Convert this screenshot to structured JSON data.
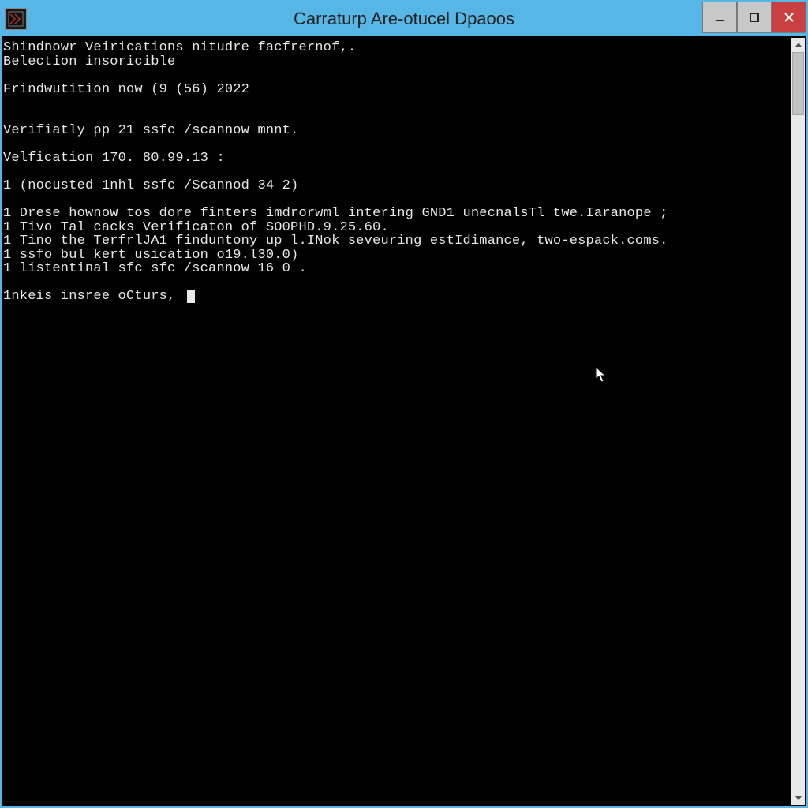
{
  "window": {
    "title": "Carraturp Are-otucel Dpaoos"
  },
  "terminal": {
    "lines": [
      "Shindnowr Veirications nitudre facfrernof,.",
      "Belection insoricible",
      "",
      "Frindwutition now (9 (56) 2022",
      "",
      "",
      "Verifiatly pp 21 ssfc /scannow mnnt.",
      "",
      "Velfication 170. 80.99.13 :",
      "",
      "1 (nocusted 1nhl ssfc /Scannod 34 2)",
      "",
      "1 Drese hownow tos dore finters imdrorwml intering GND1 unecnalsTl twe.Iaranope ;",
      "1 Tivo Tal cacks Verificaton of SO0PHD.9.25.60.",
      "1 Tino the TerfrlJA1 finduntony up l.INok seveuring estIdimance, two-espack.coms.",
      "1 ssfo bul kert usication o19.l30.0)",
      "1 listentinal sfc sfc /scannow 16 0 ."
    ],
    "prompt": "1nkeis insree oCturs, "
  },
  "controls": {
    "minimize": "minimize",
    "maximize": "maximize",
    "close": "close"
  }
}
